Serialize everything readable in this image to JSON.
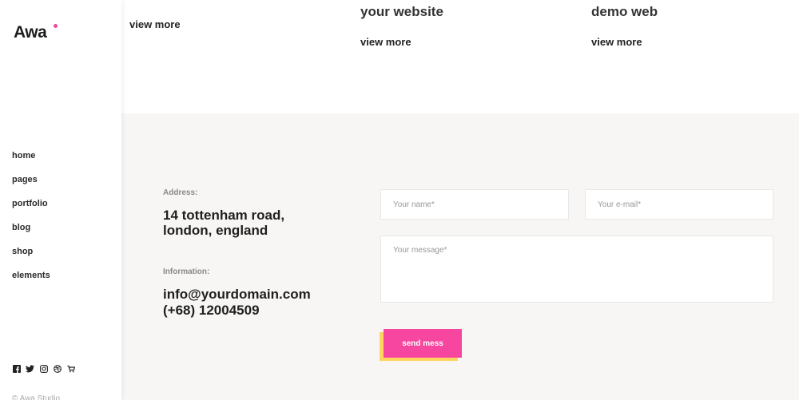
{
  "brand": {
    "logo": "Awa",
    "accent": "#f1479f"
  },
  "nav": {
    "items": [
      "home",
      "pages",
      "portfolio",
      "blog",
      "shop",
      "elements"
    ]
  },
  "social": [
    "facebook-icon",
    "twitter-icon",
    "instagram-icon",
    "dribbble-icon",
    "cart-icon"
  ],
  "footer": {
    "copyright": "© Awa Studio"
  },
  "cards": [
    {
      "heading": "",
      "link": "view more"
    },
    {
      "heading": "your website",
      "link": "view more"
    },
    {
      "heading": "demo web",
      "link": "view more"
    }
  ],
  "contact": {
    "address_label": "Address:",
    "address_line1": "14 tottenham road,",
    "address_line2": "london, england",
    "info_label": "Information:",
    "email": "info@yourdomain.com",
    "phone": "(+68) 12004509",
    "name_placeholder": "Your name*",
    "email_placeholder": "Your e-mail*",
    "message_placeholder": "Your message*",
    "submit": "send mess"
  },
  "colors": {
    "highlight": "#fdd55f",
    "button": "#f6469f",
    "section_bg": "#f7f6f5"
  }
}
